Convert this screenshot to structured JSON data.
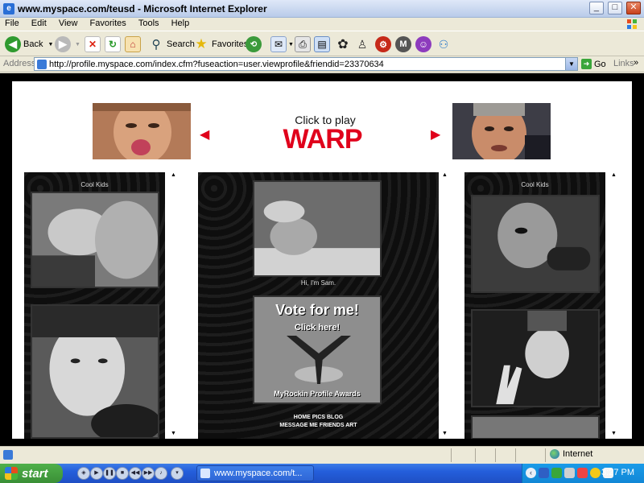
{
  "window": {
    "title": "www.myspace.com/teusd - Microsoft Internet Explorer",
    "controls": {
      "minimize": "_",
      "maximize": "□",
      "close": "✕"
    }
  },
  "menu": [
    "File",
    "Edit",
    "View",
    "Favorites",
    "Tools",
    "Help"
  ],
  "toolbar": {
    "back_label": "Back",
    "search_label": "Search",
    "favorites_label": "Favorites"
  },
  "address": {
    "label": "Address",
    "url": "http://profile.myspace.com/index.cfm?fuseaction=user.viewprofile&friendid=23370634",
    "go_label": "Go",
    "links_label": "Links"
  },
  "page": {
    "banner_line1": "Click to play",
    "banner_line2": "WARP",
    "left_caption": "Cool Kids",
    "right_caption": "Cool Kids",
    "center_caption": "Hi, I'm Sam.",
    "vote_line1": "Vote for me!",
    "vote_line2": "Click here!",
    "vote_line3": "MyRockin Profile Awards",
    "nav_line1": "HOME PICS BLOG",
    "nav_line2": "MESSAGE ME FRIENDS ART"
  },
  "status": {
    "zone": "Internet"
  },
  "taskbar": {
    "start_label": "start",
    "task_label": "www.myspace.com/t...",
    "clock": "3:27 PM"
  },
  "colors": {
    "accent_red": "#e0001b",
    "panel_bg": "#111111"
  }
}
